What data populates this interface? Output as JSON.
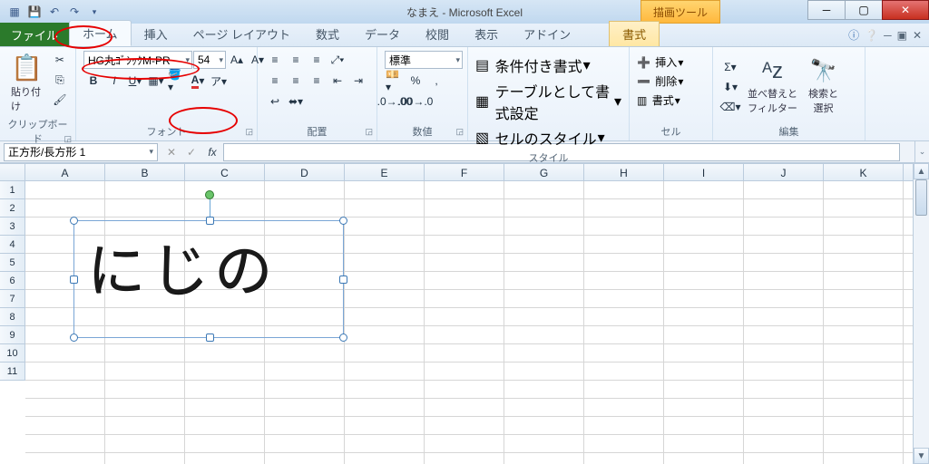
{
  "title": "なまえ - Microsoft Excel",
  "contextual_tab": "描画ツール",
  "tabs": {
    "file": "ファイル",
    "home": "ホーム",
    "insert": "挿入",
    "page_layout": "ページ レイアウト",
    "formulas": "数式",
    "data": "データ",
    "review": "校閲",
    "view": "表示",
    "addins": "アドイン",
    "format": "書式"
  },
  "ribbon": {
    "clipboard": {
      "paste": "貼り付け",
      "label": "クリップボード"
    },
    "font": {
      "font_name": "HG丸ｺﾞｼｯｸM-PR",
      "font_size": "54",
      "label": "フォント"
    },
    "alignment": {
      "label": "配置"
    },
    "number": {
      "format": "標準",
      "label": "数値"
    },
    "styles": {
      "cond": "条件付き書式",
      "table": "テーブルとして書式設定",
      "cell": "セルのスタイル",
      "label": "スタイル"
    },
    "cells": {
      "insert": "挿入",
      "delete": "削除",
      "format": "書式",
      "label": "セル"
    },
    "editing": {
      "sort": "並べ替えと\nフィルター",
      "find": "検索と\n選択",
      "label": "編集"
    }
  },
  "formula_bar": {
    "name_box": "正方形/長方形 1",
    "fx": "fx"
  },
  "columns": [
    "A",
    "B",
    "C",
    "D",
    "E",
    "F",
    "G",
    "H",
    "I",
    "J",
    "K"
  ],
  "rows": [
    "1",
    "2",
    "3",
    "4",
    "5",
    "6",
    "7",
    "8",
    "9",
    "10",
    "11"
  ],
  "shape_text": "にじの"
}
